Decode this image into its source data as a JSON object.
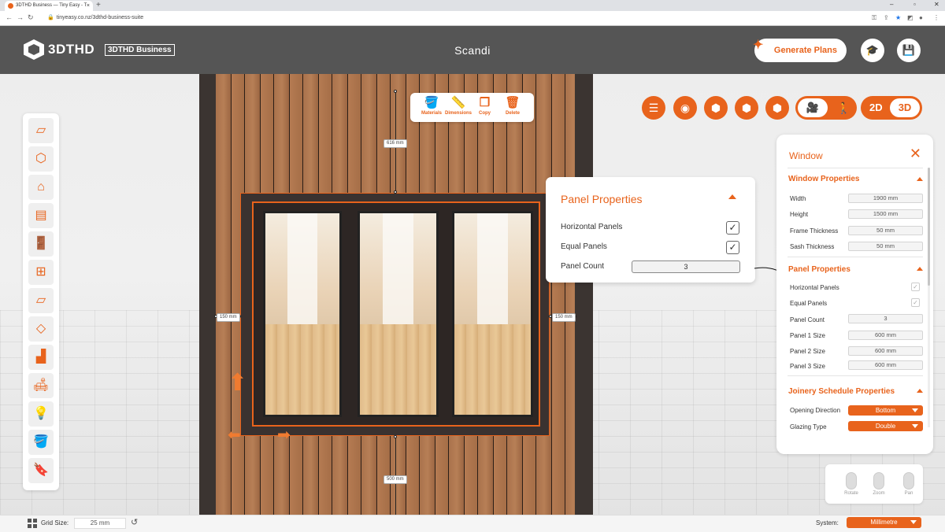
{
  "browser": {
    "tab_title": "3DTHD Business — Tiny Easy - T",
    "tab_close": "×",
    "new_tab": "+",
    "url": "tinyeasy.co.nz/3dthd-business-suite"
  },
  "header": {
    "logo_text": "3DTHD",
    "badge": "3DTHD Business",
    "project_title": "Scandi",
    "generate_plans": "Generate Plans"
  },
  "context_toolbar": {
    "materials": "Materials",
    "dimensions": "Dimensions",
    "copy": "Copy",
    "delete": "Delete"
  },
  "dimensions": {
    "top": "616 mm",
    "left": "150 mm",
    "right": "150 mm",
    "bottom": "500 mm"
  },
  "view_toggle": {
    "mode_2d": "2D",
    "mode_3d": "3D"
  },
  "panel_popout": {
    "title": "Panel Properties",
    "horizontal_panels": "Horizontal Panels",
    "equal_panels": "Equal Panels",
    "panel_count_label": "Panel Count",
    "panel_count": "3"
  },
  "side_panel": {
    "title": "Window",
    "window_properties": {
      "heading": "Window Properties",
      "width_label": "Width",
      "width": "1900 mm",
      "height_label": "Height",
      "height": "1500 mm",
      "frame_label": "Frame Thickness",
      "frame": "50 mm",
      "sash_label": "Sash Thickness",
      "sash": "50 mm"
    },
    "panel_properties": {
      "heading": "Panel Properties",
      "horizontal_label": "Horizontal Panels",
      "equal_label": "Equal Panels",
      "count_label": "Panel Count",
      "count": "3",
      "p1_label": "Panel 1 Size",
      "p1": "600 mm",
      "p2_label": "Panel 2 Size",
      "p2": "600 mm",
      "p3_label": "Panel 3 Size",
      "p3": "600 mm"
    },
    "joinery": {
      "heading": "Joinery Schedule Properties",
      "opening_label": "Opening Direction",
      "opening": "Bottom",
      "glazing_label": "Glazing Type",
      "glazing": "Double"
    }
  },
  "mouse_help": {
    "rotate": "Rotate",
    "zoom": "Zoom",
    "pan": "Pan"
  },
  "status_bar": {
    "grid_label": "Grid Size:",
    "grid_value": "25 mm",
    "system_label": "System:",
    "system_value": "Millimetre"
  },
  "colors": {
    "accent": "#e8631c",
    "header_bg": "#555555"
  }
}
